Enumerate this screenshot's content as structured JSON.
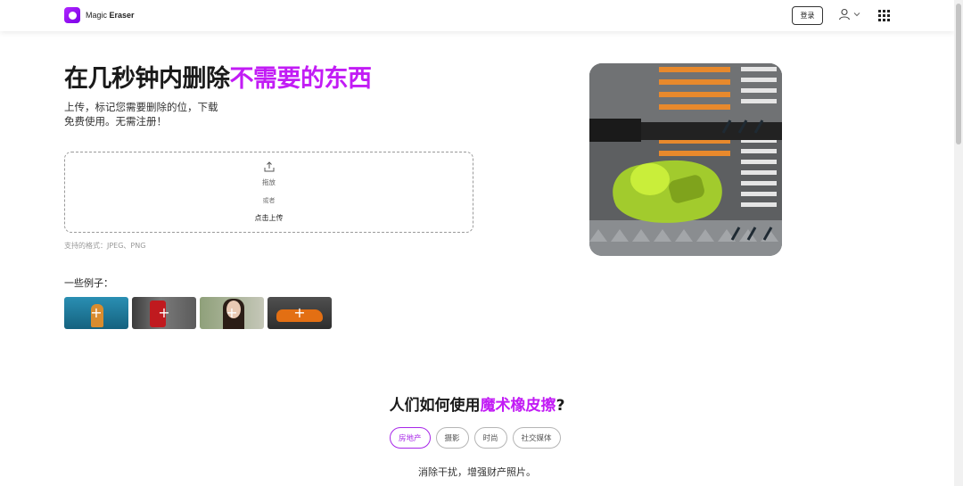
{
  "header": {
    "logo_word1": "Magic",
    "logo_word2": "Eraser",
    "login_label": "登录",
    "user_icon": "user-icon",
    "apps_icon": "grid-icon"
  },
  "hero": {
    "title_plain": "在几秒钟内删除",
    "title_accent": "不需要的东西",
    "subtitle_line1": "上传，标记您需要删除的位，下载",
    "subtitle_line2": "免费使用。无需注册！",
    "dropzone": {
      "icon": "upload-icon",
      "drag_text": "拖放",
      "or_text": "或者",
      "click_text": "点击上传"
    },
    "formats_text": "支持的格式：JPEG、PNG",
    "examples_label": "一些例子：",
    "examples_plus": "+",
    "accent_color": "#c21cf5"
  },
  "usage": {
    "title_plain": "人们如何使用",
    "title_accent": "魔术橡皮擦",
    "title_end": "?",
    "tabs": [
      {
        "label": "房地产",
        "active": true
      },
      {
        "label": "摄影",
        "active": false
      },
      {
        "label": "时尚",
        "active": false
      },
      {
        "label": "社交媒体",
        "active": false
      }
    ],
    "description": "消除干扰，增强财产照片。"
  }
}
